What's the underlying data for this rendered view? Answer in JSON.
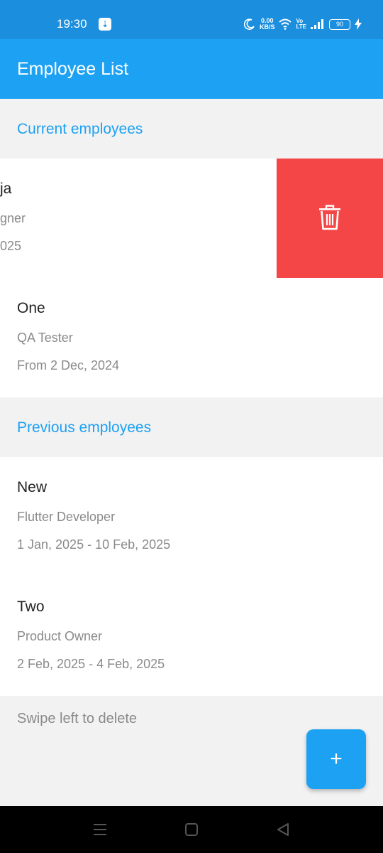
{
  "status_bar": {
    "time": "19:30",
    "usb_icon": "usb-icon",
    "net_speed_value": "0.00",
    "net_speed_unit": "KB/S",
    "volte_top": "Vo",
    "volte_bottom": "LTE",
    "battery": "90"
  },
  "app_bar": {
    "title": "Employee List",
    "color": "#1da1f2"
  },
  "sections": {
    "current": {
      "title": "Current employees",
      "employees": [
        {
          "name": "ja",
          "role": "gner",
          "dates": "025"
        },
        {
          "name": "One",
          "role": "QA Tester",
          "dates": "From 2 Dec, 2024"
        }
      ]
    },
    "previous": {
      "title": "Previous employees",
      "employees": [
        {
          "name": "New",
          "role": "Flutter Developer",
          "dates": "1 Jan, 2025 - 10 Feb, 2025"
        },
        {
          "name": "Two",
          "role": "Product Owner",
          "dates": "2 Feb, 2025 - 4 Feb, 2025"
        }
      ]
    }
  },
  "delete_action": {
    "icon": "trash-icon",
    "color": "#f44646"
  },
  "hint": "Swipe left to delete",
  "fab": {
    "label": "+"
  },
  "nav_bar": {
    "icons": [
      "menu-icon",
      "home-square-icon",
      "back-triangle-icon"
    ]
  }
}
